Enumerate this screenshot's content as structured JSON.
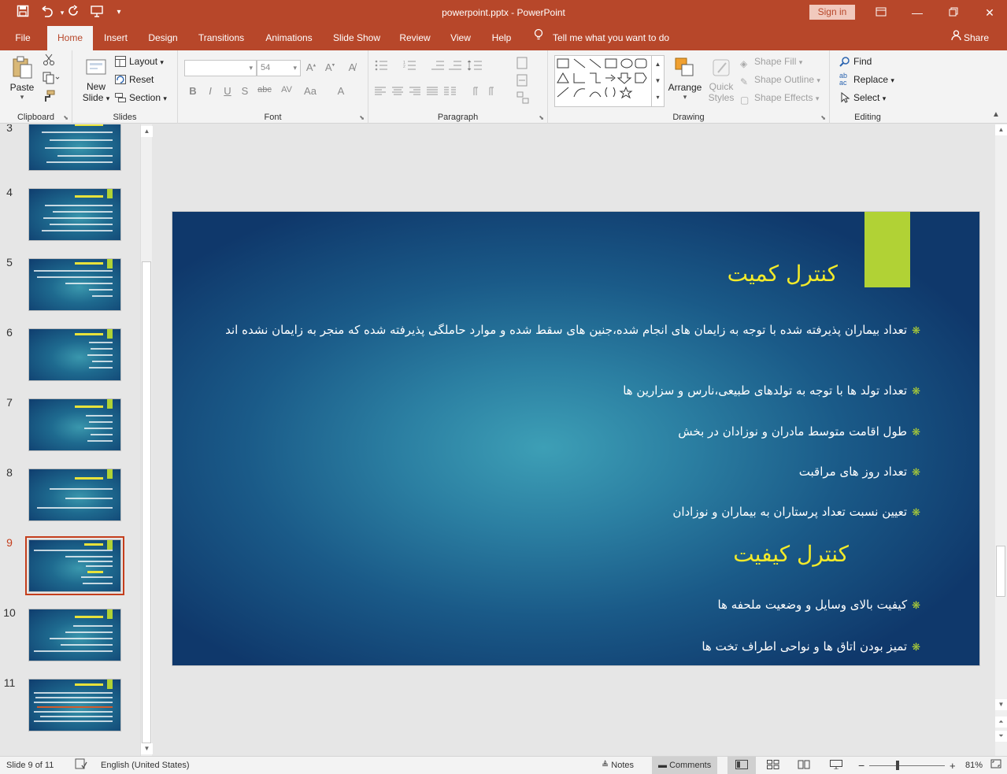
{
  "window": {
    "title": "powerpoint.pptx - PowerPoint",
    "signin": "Sign in",
    "icons": {
      "save": "save-icon",
      "undo": "undo-icon",
      "redo": "redo-icon",
      "start": "start-from-beginning-icon"
    }
  },
  "tabs": [
    {
      "label": "File"
    },
    {
      "label": "Home"
    },
    {
      "label": "Insert"
    },
    {
      "label": "Design"
    },
    {
      "label": "Transitions"
    },
    {
      "label": "Animations"
    },
    {
      "label": "Slide Show"
    },
    {
      "label": "Review"
    },
    {
      "label": "View"
    },
    {
      "label": "Help"
    }
  ],
  "active_tab": "Home",
  "tellme": "Tell me what you want to do",
  "share": "Share",
  "ribbon": {
    "clipboard": {
      "label": "Clipboard",
      "paste": "Paste"
    },
    "slides": {
      "label": "Slides",
      "new_slide_1": "New",
      "new_slide_2": "Slide",
      "layout": "Layout",
      "reset": "Reset",
      "section": "Section"
    },
    "font": {
      "label": "Font",
      "size": "54",
      "bold": "B",
      "italic": "I",
      "underline": "U",
      "shadow": "S",
      "strike": "abc",
      "spacing": "AV",
      "case": "Aa",
      "color": "A"
    },
    "paragraph": {
      "label": "Paragraph"
    },
    "drawing": {
      "label": "Drawing",
      "arrange": "Arrange",
      "quick_1": "Quick",
      "quick_2": "Styles",
      "shape_fill": "Shape Fill",
      "shape_outline": "Shape Outline",
      "shape_effects": "Shape Effects"
    },
    "editing": {
      "label": "Editing",
      "find": "Find",
      "replace": "Replace",
      "select": "Select"
    }
  },
  "thumbnails": [
    {
      "num": "3"
    },
    {
      "num": "4"
    },
    {
      "num": "5"
    },
    {
      "num": "6"
    },
    {
      "num": "7"
    },
    {
      "num": "8"
    },
    {
      "num": "9"
    },
    {
      "num": "10"
    },
    {
      "num": "11"
    }
  ],
  "selected_slide": "9",
  "slide": {
    "title1": "کنترل کمیت",
    "bullets1": [
      "تعداد بیماران پذیرفته شده با توجه به زایمان های انجام شده،جنین های سقط شده و موارد حاملگی پذیرفته شده که منجر به زایمان نشده اند",
      "تعداد تولد ها با توجه به تولدهای طبیعی،نارس و سزارین ها",
      "طول اقامت متوسط مادران و نوزادان در بخش",
      "تعداد روز های مراقبت",
      "تعیین نسبت تعداد پرستاران به بیماران و نوزادان"
    ],
    "title2": "کنترل کیفیت",
    "bullets2": [
      "کیفیت بالای وسایل و وضعیت ملحفه ها",
      "تمیز بودن اتاق ها و نواحی اطراف تخت ها"
    ],
    "bullet_mark": "❋",
    "colors": {
      "title": "#f2ea2a",
      "accent": "#b1d235",
      "text": "#ffffff"
    }
  },
  "status": {
    "slide_info": "Slide 9 of 11",
    "language": "English (United States)",
    "notes": "Notes",
    "comments": "Comments",
    "zoom": "81%",
    "minus": "−",
    "plus": "+"
  }
}
